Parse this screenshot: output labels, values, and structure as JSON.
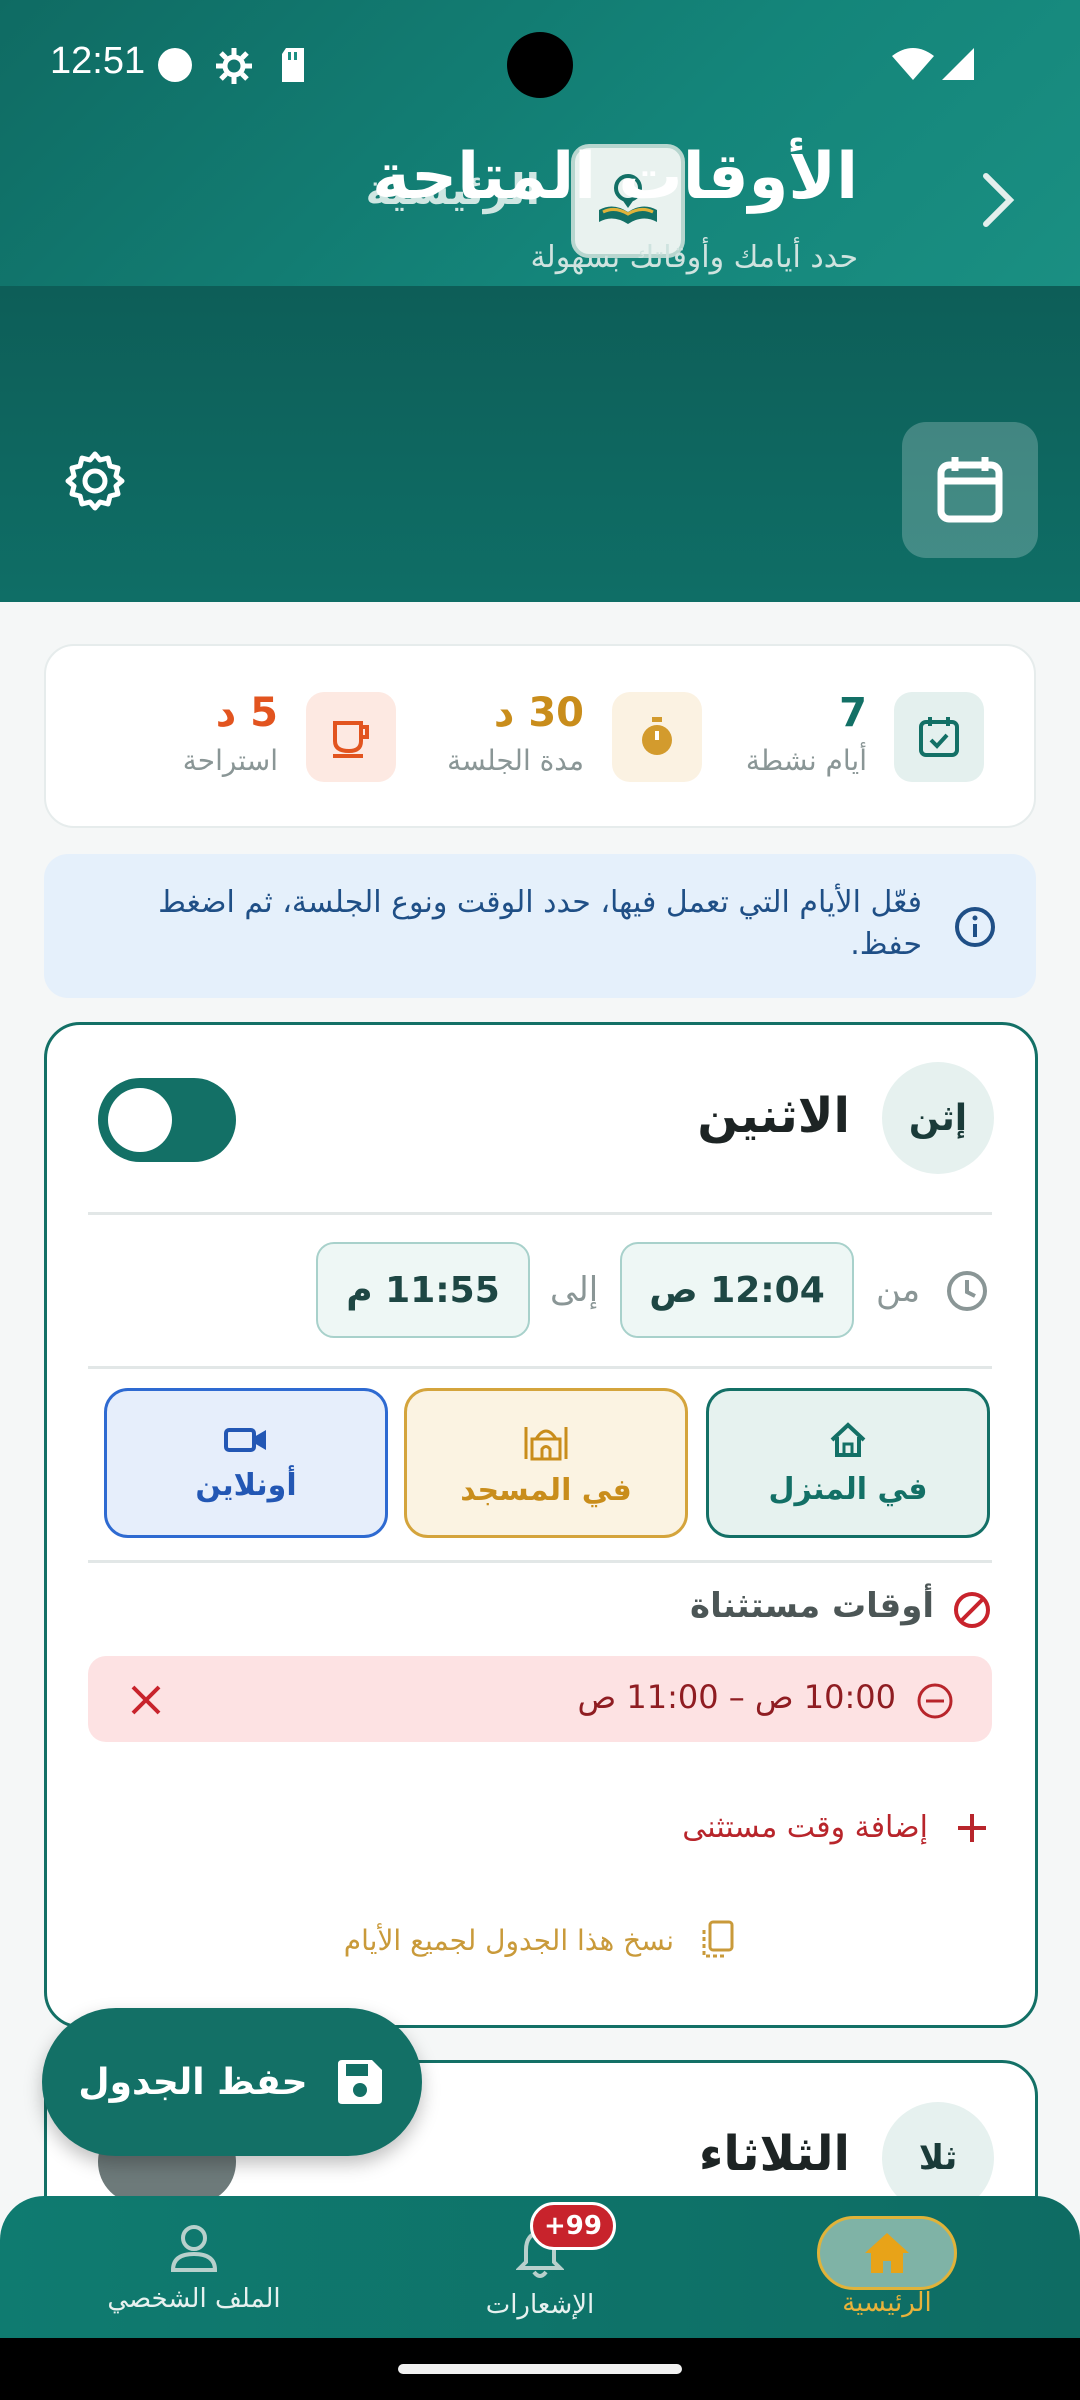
{
  "status_bar": {
    "time": "12:51"
  },
  "app_bar": {
    "title": "الرئيسية"
  },
  "hero": {
    "title": "الأوقات المتاحة",
    "subtitle": "حدد أيامك وأوقاتك بسهولة"
  },
  "stats": [
    {
      "value": "7",
      "label": "أيام نشطة",
      "icon": "calendar-check-icon"
    },
    {
      "value": "30 د",
      "label": "مدة الجلسة",
      "icon": "stopwatch-icon"
    },
    {
      "value": "5 د",
      "label": "استراحة",
      "icon": "coffee-cup-icon"
    }
  ],
  "info": {
    "text": "فعّل الأيام التي تعمل فيها، حدد الوقت ونوع الجلسة، ثم اضغط حفظ."
  },
  "days": [
    {
      "abbr": "إثن",
      "name": "الاثنين",
      "enabled": true,
      "from_label": "من",
      "to_label": "إلى",
      "from_time": "12:04 ص",
      "to_time": "11:55 م",
      "session_types": [
        {
          "label": "في المنزل",
          "icon": "home-icon",
          "selected": true
        },
        {
          "label": "في المسجد",
          "icon": "mosque-icon",
          "selected": true
        },
        {
          "label": "أونلاين",
          "icon": "video-icon",
          "selected": true
        }
      ],
      "exceptions_title": "أوقات مستثناة",
      "exceptions": [
        {
          "range": "10:00 ص  –  11:00 ص"
        }
      ],
      "add_exception": "إضافة وقت مستثنى",
      "copy_schedule": "نسخ هذا الجدول لجميع الأيام"
    },
    {
      "abbr": "ثلا",
      "name": "الثلاثاء",
      "enabled": false
    }
  ],
  "fab": {
    "label": "حفظ الجدول"
  },
  "bottom_nav": [
    {
      "label": "الرئيسية",
      "icon": "home-icon",
      "active": true
    },
    {
      "label": "الإشعارات",
      "icon": "bell-icon",
      "badge": "+99"
    },
    {
      "label": "الملف الشخصي",
      "icon": "person-icon"
    }
  ],
  "colors": {
    "primary": "#137066",
    "accent": "#e0b33a",
    "danger": "#c8232c"
  }
}
